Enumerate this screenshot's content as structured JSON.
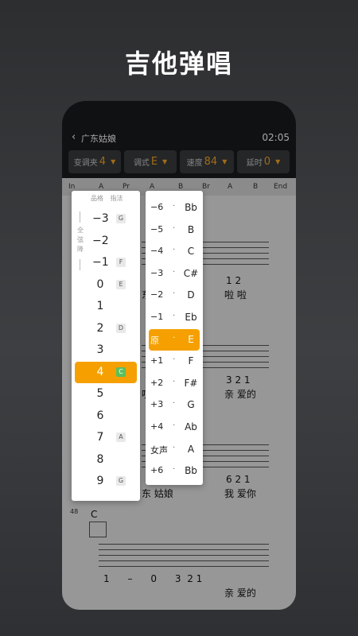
{
  "hero": {
    "title": "吉他弹唱"
  },
  "topbar": {
    "back_icon": "chevron-left-icon",
    "song_title": "广东姑娘",
    "time": "02:05"
  },
  "controls": [
    {
      "label": "变调夹",
      "value": "4"
    },
    {
      "label": "调式",
      "value": "E"
    },
    {
      "label": "速度",
      "value": "84"
    },
    {
      "label": "延时",
      "value": "0"
    }
  ],
  "markers": [
    "In",
    "A",
    "Pr",
    "A",
    "B",
    "Br",
    "A",
    "B",
    "End"
  ],
  "fret_panel": {
    "header_fret": "品格",
    "header_finger": "指法",
    "side_label": "全弦降",
    "rows": [
      {
        "num": "−3",
        "key": "G"
      },
      {
        "num": "−2",
        "key": ""
      },
      {
        "num": "−1",
        "key": "F"
      },
      {
        "num": "0",
        "key": "E"
      },
      {
        "num": "1",
        "key": ""
      },
      {
        "num": "2",
        "key": "D"
      },
      {
        "num": "3",
        "key": ""
      },
      {
        "num": "4",
        "key": "C",
        "selected": true
      },
      {
        "num": "5",
        "key": ""
      },
      {
        "num": "6",
        "key": ""
      },
      {
        "num": "7",
        "key": "A"
      },
      {
        "num": "8",
        "key": ""
      },
      {
        "num": "9",
        "key": "G"
      }
    ]
  },
  "key_panel": {
    "rows": [
      {
        "a": "−6",
        "b": "Bb"
      },
      {
        "a": "−5",
        "b": "B"
      },
      {
        "a": "−4",
        "b": "C"
      },
      {
        "a": "−3",
        "b": "C#"
      },
      {
        "a": "−2",
        "b": "D"
      },
      {
        "a": "−1",
        "b": "Eb"
      },
      {
        "a": "原",
        "b": "E",
        "selected": true
      },
      {
        "a": "+1",
        "b": "F"
      },
      {
        "a": "+2",
        "b": "F#"
      },
      {
        "a": "+3",
        "b": "G"
      },
      {
        "a": "+4",
        "b": "Ab"
      },
      {
        "a": "女声",
        "b": "A"
      },
      {
        "a": "+6",
        "b": "Bb"
      }
    ]
  },
  "score": {
    "measure_number": "48",
    "chord": "C",
    "lines": [
      {
        "notes": "1  2",
        "lyrics": "啦  啦",
        "left_lyric": "东"
      },
      {
        "notes": "3  2 1",
        "lyrics": "亲  爱的",
        "left_lyric": "哎"
      },
      {
        "notes": "6  2 1",
        "lyrics": "我  爱你",
        "left_lyric": "东  姑娘"
      },
      {
        "notes": "1      –      0      3  2 1",
        "lyrics": "亲  爱的"
      }
    ]
  }
}
